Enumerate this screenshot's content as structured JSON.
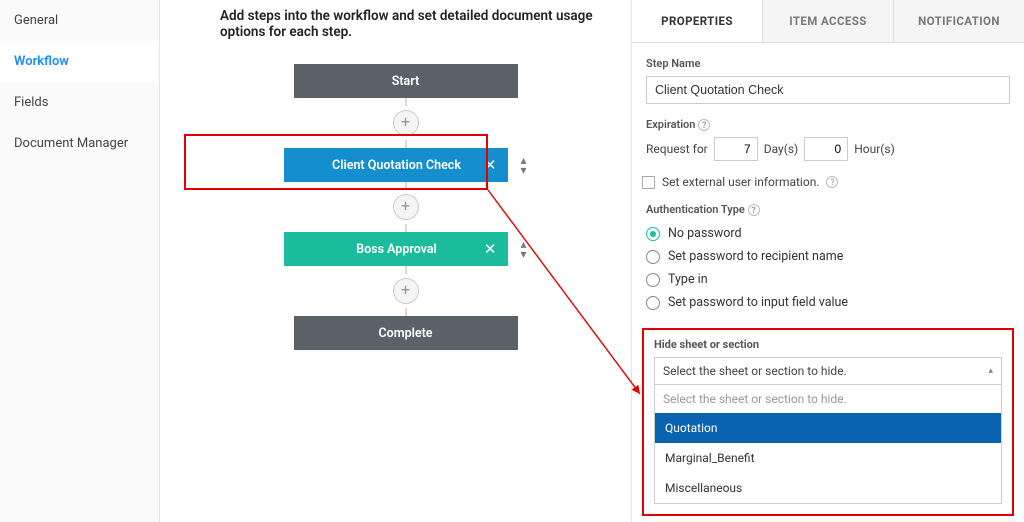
{
  "sidebar": {
    "items": [
      {
        "label": "General"
      },
      {
        "label": "Workflow"
      },
      {
        "label": "Fields"
      },
      {
        "label": "Document Manager"
      }
    ]
  },
  "intro": "Add steps into the workflow and set detailed document usage options for each step.",
  "flow": {
    "start": "Start",
    "step1": "Client Quotation Check",
    "step2": "Boss Approval",
    "complete": "Complete",
    "add": "+",
    "up": "▴",
    "down": "▾",
    "close": "✕"
  },
  "tabs": {
    "properties": "PROPERTIES",
    "item_access": "ITEM ACCESS",
    "notification": "NOTIFICATION"
  },
  "props": {
    "step_name_label": "Step Name",
    "step_name_value": "Client Quotation Check",
    "expiration_label": "Expiration",
    "request_for": "Request for",
    "days_value": "7",
    "days_label": "Day(s)",
    "hours_value": "0",
    "hours_label": "Hour(s)",
    "set_external": "Set external user information.",
    "auth_type_label": "Authentication Type",
    "auth_options": [
      "No password",
      "Set password to recipient name",
      "Type in",
      "Set password to input field value"
    ],
    "help": "?"
  },
  "hide": {
    "label": "Hide sheet or section",
    "selected": "Select the sheet or section to hide.",
    "placeholder": "Select the sheet or section to hide.",
    "caret": "▴",
    "options": [
      "Quotation",
      "Marginal_Benefit",
      "Miscellaneous"
    ]
  }
}
